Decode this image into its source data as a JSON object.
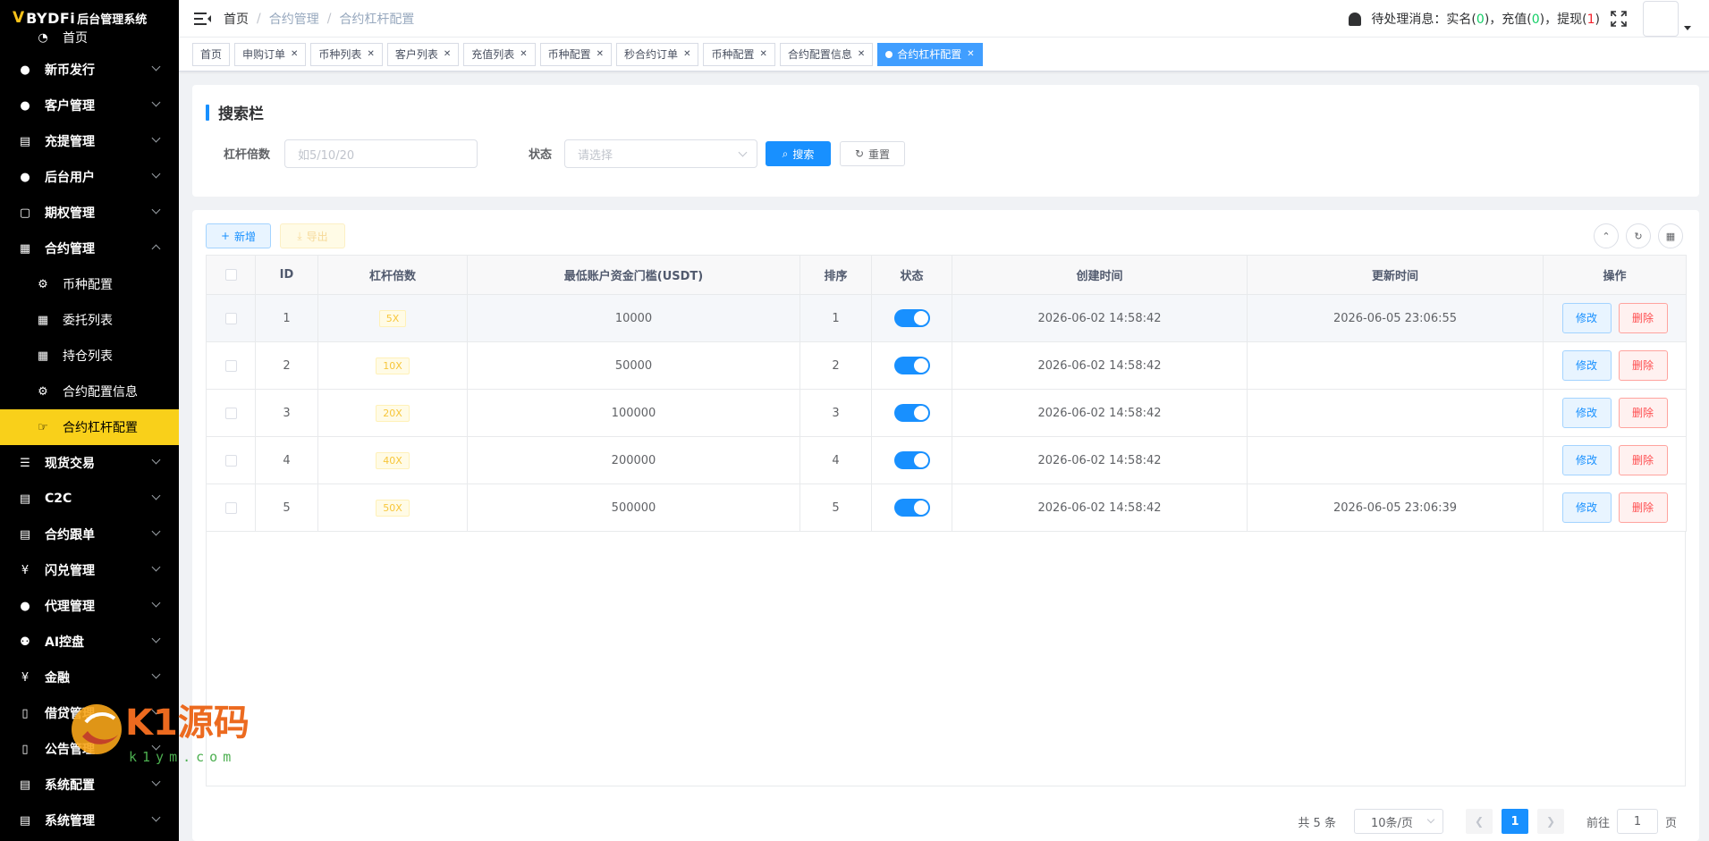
{
  "app": {
    "logo_mark": "V",
    "brand": "BYDFi",
    "system_name": "后台管理系统"
  },
  "sidebar": {
    "home": "首页",
    "items": [
      {
        "label": "新币发行",
        "icon": "user"
      },
      {
        "label": "客户管理",
        "icon": "user"
      },
      {
        "label": "充提管理",
        "icon": "doc"
      },
      {
        "label": "后台用户",
        "icon": "people"
      },
      {
        "label": "期权管理",
        "icon": "monitor"
      },
      {
        "label": "合约管理",
        "icon": "grid"
      }
    ],
    "sub_items": [
      {
        "label": "币种配置",
        "icon": "gear"
      },
      {
        "label": "委托列表",
        "icon": "table"
      },
      {
        "label": "持仓列表",
        "icon": "table"
      },
      {
        "label": "合约配置信息",
        "icon": "gear"
      },
      {
        "label": "合约杠杆配置",
        "icon": "thumb"
      }
    ],
    "items_after": [
      {
        "label": "现货交易",
        "icon": "list"
      },
      {
        "label": "C2C",
        "icon": "doc"
      },
      {
        "label": "合约跟单",
        "icon": "doc"
      },
      {
        "label": "闪兑管理",
        "icon": "yen"
      },
      {
        "label": "代理管理",
        "icon": "user"
      },
      {
        "label": "AI控盘",
        "icon": "robot"
      },
      {
        "label": "金融",
        "icon": "yen"
      },
      {
        "label": "借贷管理",
        "icon": "book"
      },
      {
        "label": "公告管理",
        "icon": "book"
      },
      {
        "label": "系统配置",
        "icon": "doc"
      },
      {
        "label": "系统管理",
        "icon": "doc"
      }
    ]
  },
  "header": {
    "breadcrumb": [
      "首页",
      "合约管理",
      "合约杠杆配置"
    ],
    "notice_prefix": "待处理消息：",
    "kyc_label": "实名(",
    "kyc_count": "0",
    "deposit_label": "充值(",
    "deposit_count": "0",
    "withdraw_label": "提现(",
    "withdraw_count": "1",
    "close_paren": ")",
    "comma": "，"
  },
  "tags": [
    "首页",
    "申购订单",
    "币种列表",
    "客户列表",
    "充值列表",
    "币种配置",
    "秒合约订单",
    "币种配置",
    "合约配置信息",
    "合约杠杆配置"
  ],
  "search": {
    "title": "搜索栏",
    "leverage_label": "杠杆倍数",
    "leverage_placeholder": "如5/10/20",
    "status_label": "状态",
    "status_placeholder": "请选择",
    "search_btn": "搜索",
    "reset_btn": "重置"
  },
  "toolbar": {
    "add": "新增",
    "export": "导出"
  },
  "table": {
    "columns": [
      "ID",
      "杠杆倍数",
      "最低账户资金门槛(USDT)",
      "排序",
      "状态",
      "创建时间",
      "更新时间",
      "操作"
    ],
    "rows": [
      {
        "id": "1",
        "leverage": "5X",
        "min_balance": "10000",
        "sort": "1",
        "enabled": true,
        "created": "2026-06-02 14:58:42",
        "updated": "2026-06-05 23:06:55"
      },
      {
        "id": "2",
        "leverage": "10X",
        "min_balance": "50000",
        "sort": "2",
        "enabled": true,
        "created": "2026-06-02 14:58:42",
        "updated": ""
      },
      {
        "id": "3",
        "leverage": "20X",
        "min_balance": "100000",
        "sort": "3",
        "enabled": true,
        "created": "2026-06-02 14:58:42",
        "updated": ""
      },
      {
        "id": "4",
        "leverage": "40X",
        "min_balance": "200000",
        "sort": "4",
        "enabled": true,
        "created": "2026-06-02 14:58:42",
        "updated": ""
      },
      {
        "id": "5",
        "leverage": "50X",
        "min_balance": "500000",
        "sort": "5",
        "enabled": true,
        "created": "2026-06-02 14:58:42",
        "updated": "2026-06-05 23:06:39"
      }
    ],
    "edit_btn": "修改",
    "delete_btn": "删除"
  },
  "pagination": {
    "total": "共 5 条",
    "page_size": "10条/页",
    "current": "1",
    "goto_prefix": "前往",
    "goto_value": "1",
    "goto_suffix": "页"
  },
  "watermark": {
    "title": "K1源码",
    "url": "k1ym.com"
  },
  "colors": {
    "accent": "#1890ff",
    "sidebar_active": "#f9d01a",
    "sidebar_bg": "#000000",
    "danger": "#ff4d4f",
    "success": "#13ce66"
  }
}
